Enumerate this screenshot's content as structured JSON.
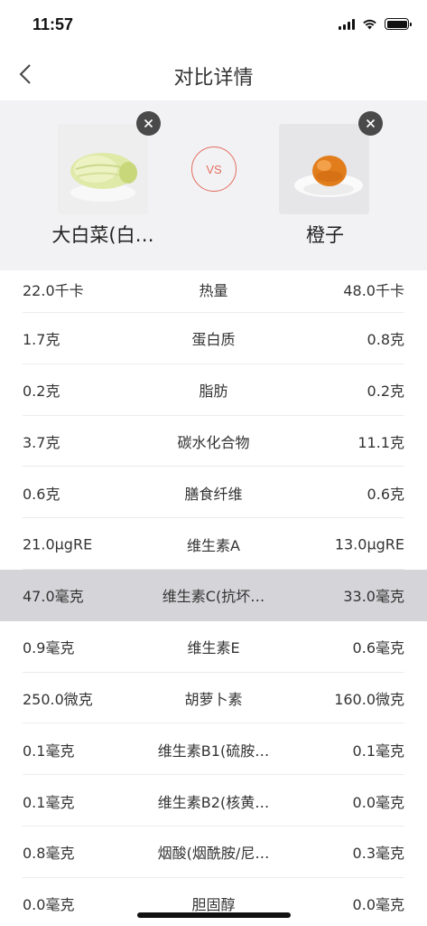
{
  "status_bar": {
    "time": "11:57"
  },
  "nav": {
    "title": "对比详情"
  },
  "compare": {
    "left_name": "大白菜(白…",
    "right_name": "橙子",
    "vs_label": "VS"
  },
  "nutrients": [
    {
      "left": "22.0千卡",
      "name": "热量",
      "right": "48.0千卡"
    },
    {
      "left": "1.7克",
      "name": "蛋白质",
      "right": "0.8克"
    },
    {
      "left": "0.2克",
      "name": "脂肪",
      "right": "0.2克"
    },
    {
      "left": "3.7克",
      "name": "碳水化合物",
      "right": "11.1克"
    },
    {
      "left": "0.6克",
      "name": "膳食纤维",
      "right": "0.6克"
    },
    {
      "left": "21.0μgRE",
      "name": "维生素A",
      "right": "13.0μgRE"
    },
    {
      "left": "47.0毫克",
      "name": "维生素C(抗坏…",
      "right": "33.0毫克"
    },
    {
      "left": "0.9毫克",
      "name": "维生素E",
      "right": "0.6毫克"
    },
    {
      "left": "250.0微克",
      "name": "胡萝卜素",
      "right": "160.0微克"
    },
    {
      "left": "0.1毫克",
      "name": "维生素B1(硫胺…",
      "right": "0.1毫克"
    },
    {
      "left": "0.1毫克",
      "name": "维生素B2(核黄…",
      "right": "0.0毫克"
    },
    {
      "left": "0.8毫克",
      "name": "烟酸(烟酰胺/尼…",
      "right": "0.3毫克"
    },
    {
      "left": "0.0毫克",
      "name": "胆固醇",
      "right": "0.0毫克"
    }
  ]
}
